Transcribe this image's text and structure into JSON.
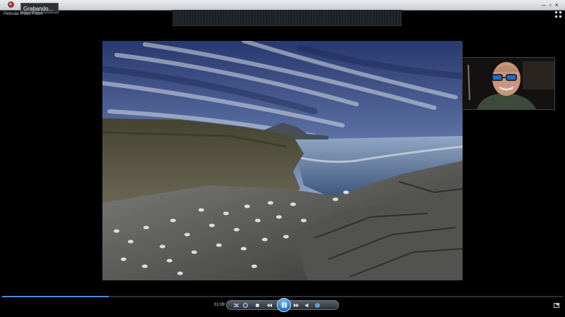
{
  "titlebar": {
    "recording_label": "Grabando...",
    "app_name": "Película Vídeo Fotos"
  },
  "player": {
    "time": "01:09",
    "progress": 0.19,
    "accent": "#4a8fd8"
  },
  "icons": {
    "record": "record-icon",
    "fullscreen": "fullscreen-icon",
    "shuffle": "shuffle-icon",
    "repeat": "repeat-icon",
    "stop": "stop-icon",
    "previous": "previous-icon",
    "play_pause": "pause-icon",
    "next": "next-icon",
    "mute": "speaker-icon",
    "volume": "volume-slider",
    "switch_view": "switch-view-icon"
  }
}
